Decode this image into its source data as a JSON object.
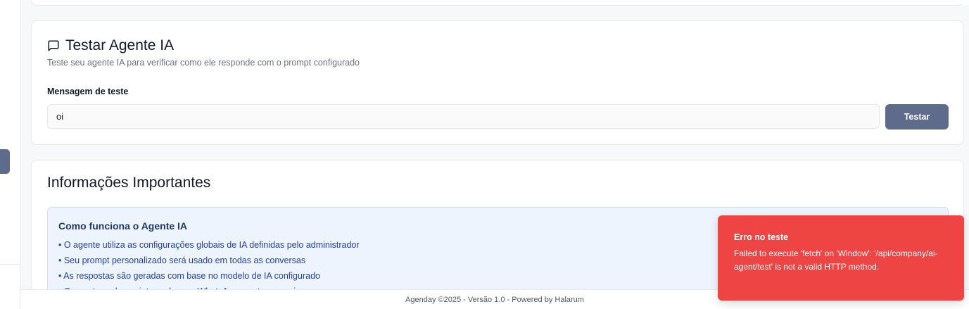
{
  "test_card": {
    "title": "Testar Agente IA",
    "subtitle": "Teste seu agente IA para verificar como ele responde com o prompt configurado",
    "field_label": "Mensagem de teste",
    "input_value": "oi",
    "button_label": "Testar"
  },
  "info_card": {
    "title": "Informações Importantes",
    "box_title": "Como funciona o Agente IA",
    "items": [
      "• O agente utiliza as configurações globais de IA definidas pelo administrador",
      "• Seu prompt personalizado será usado em todas as conversas",
      "• As respostas são geradas com base no modelo de IA configurado",
      "• O agente pode ser integrado com WhatsApp e outros canais"
    ]
  },
  "footer": {
    "text": "Agenday ©2025 - Versão 1.0 - Powered by Halarum"
  },
  "toast": {
    "title": "Erro no teste",
    "message": "Failed to execute 'fetch' on 'Window': '/api/company/ai-agent/test' is not a valid HTTP method."
  },
  "colors": {
    "accent": "#5f6b8a",
    "error": "#ef4444",
    "info_bg": "#eef4fd",
    "info_text": "#1e40af"
  },
  "icons": {
    "test_title": "message-square-icon"
  }
}
